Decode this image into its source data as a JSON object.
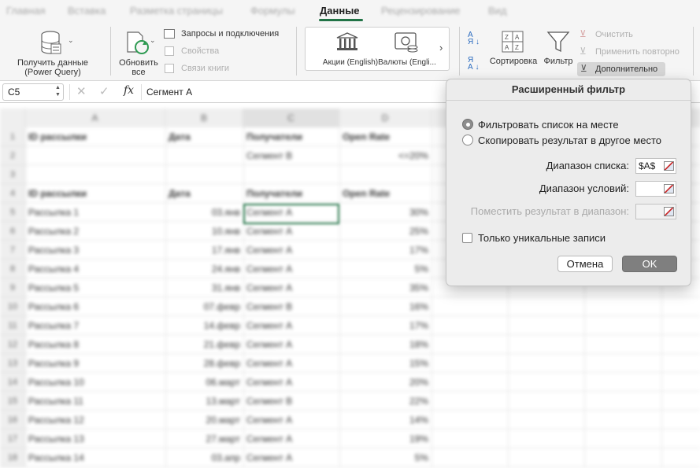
{
  "ribbon_tabs": [
    {
      "label": "Главная",
      "active": false
    },
    {
      "label": "Вставка",
      "active": false
    },
    {
      "label": "Разметка страницы",
      "active": false
    },
    {
      "label": "Формулы",
      "active": false
    },
    {
      "label": "Данные",
      "active": true
    },
    {
      "label": "Рецензирование",
      "active": false
    },
    {
      "label": "Вид",
      "active": false
    }
  ],
  "ribbon": {
    "get_data": "Получить данные (Power Query)",
    "refresh_all": "Обновить все",
    "queries": "Запросы и подключения",
    "properties": "Свойства",
    "edit_links": "Связи книги",
    "stocks": "Акции (English)",
    "currencies": "Валюты (Engli...",
    "sort": "Сортировка",
    "filter": "Фильтр",
    "clear": "Очистить",
    "reapply": "Применить повторно",
    "advanced": "Дополнительно"
  },
  "formula_bar": {
    "name_box": "C5",
    "fx": "fx",
    "content": "Сегмент А"
  },
  "sheet": {
    "columns": [
      "A",
      "B",
      "C",
      "D"
    ],
    "rows": [
      {
        "n": "1",
        "a": "ID рассылки",
        "b": "Дата",
        "c": "Получатели",
        "d": "Open Rate",
        "bold": true
      },
      {
        "n": "2",
        "a": "",
        "b": "",
        "c": "Сегмент В",
        "d": "<=20%",
        "bold": false
      },
      {
        "n": "3",
        "a": "",
        "b": "",
        "c": "",
        "d": "",
        "bold": false
      },
      {
        "n": "4",
        "a": "ID рассылки",
        "b": "Дата",
        "c": "Получатели",
        "d": "Open Rate",
        "bold": true
      },
      {
        "n": "5",
        "a": "Рассылка 1",
        "b": "03.янв",
        "c": "Сегмент А",
        "d": "30%",
        "bold": false
      },
      {
        "n": "6",
        "a": "Рассылка 2",
        "b": "10.янв",
        "c": "Сегмент А",
        "d": "25%",
        "bold": false
      },
      {
        "n": "7",
        "a": "Рассылка 3",
        "b": "17.янв",
        "c": "Сегмент А",
        "d": "17%",
        "bold": false
      },
      {
        "n": "8",
        "a": "Рассылка 4",
        "b": "24.янв",
        "c": "Сегмент А",
        "d": "5%",
        "bold": false
      },
      {
        "n": "9",
        "a": "Рассылка 5",
        "b": "31.янв",
        "c": "Сегмент А",
        "d": "35%",
        "bold": false
      },
      {
        "n": "10",
        "a": "Рассылка 6",
        "b": "07.февр",
        "c": "Сегмент В",
        "d": "16%",
        "bold": false
      },
      {
        "n": "11",
        "a": "Рассылка 7",
        "b": "14.февр",
        "c": "Сегмент А",
        "d": "17%",
        "bold": false
      },
      {
        "n": "12",
        "a": "Рассылка 8",
        "b": "21.февр",
        "c": "Сегмент А",
        "d": "18%",
        "bold": false
      },
      {
        "n": "13",
        "a": "Рассылка 9",
        "b": "28.февр",
        "c": "Сегмент А",
        "d": "15%",
        "bold": false
      },
      {
        "n": "14",
        "a": "Рассылка 10",
        "b": "06.март",
        "c": "Сегмент А",
        "d": "20%",
        "bold": false
      },
      {
        "n": "15",
        "a": "Рассылка 11",
        "b": "13.март",
        "c": "Сегмент В",
        "d": "22%",
        "bold": false
      },
      {
        "n": "16",
        "a": "Рассылка 12",
        "b": "20.март",
        "c": "Сегмент А",
        "d": "14%",
        "bold": false
      },
      {
        "n": "17",
        "a": "Рассылка 13",
        "b": "27.март",
        "c": "Сегмент А",
        "d": "19%",
        "bold": false
      },
      {
        "n": "18",
        "a": "Рассылка 14",
        "b": "03.апр",
        "c": "Сегмент А",
        "d": "5%",
        "bold": false
      }
    ]
  },
  "dialog": {
    "title": "Расширенный фильтр",
    "radio_in_place": "Фильтровать список на месте",
    "radio_copy": "Скопировать результат в другое место",
    "list_range_label": "Диапазон списка:",
    "list_range_value": "$A$",
    "criteria_range_label": "Диапазон условий:",
    "criteria_range_value": "",
    "copy_to_label": "Поместить результат в диапазон:",
    "copy_to_value": "",
    "unique_label": "Только уникальные записи",
    "unique_checked": false,
    "cancel": "Отмена",
    "ok": "OK"
  },
  "colors": {
    "accent": "#217346",
    "dialog_bg": "#ececec",
    "ok_button": "#7f7f7f"
  }
}
